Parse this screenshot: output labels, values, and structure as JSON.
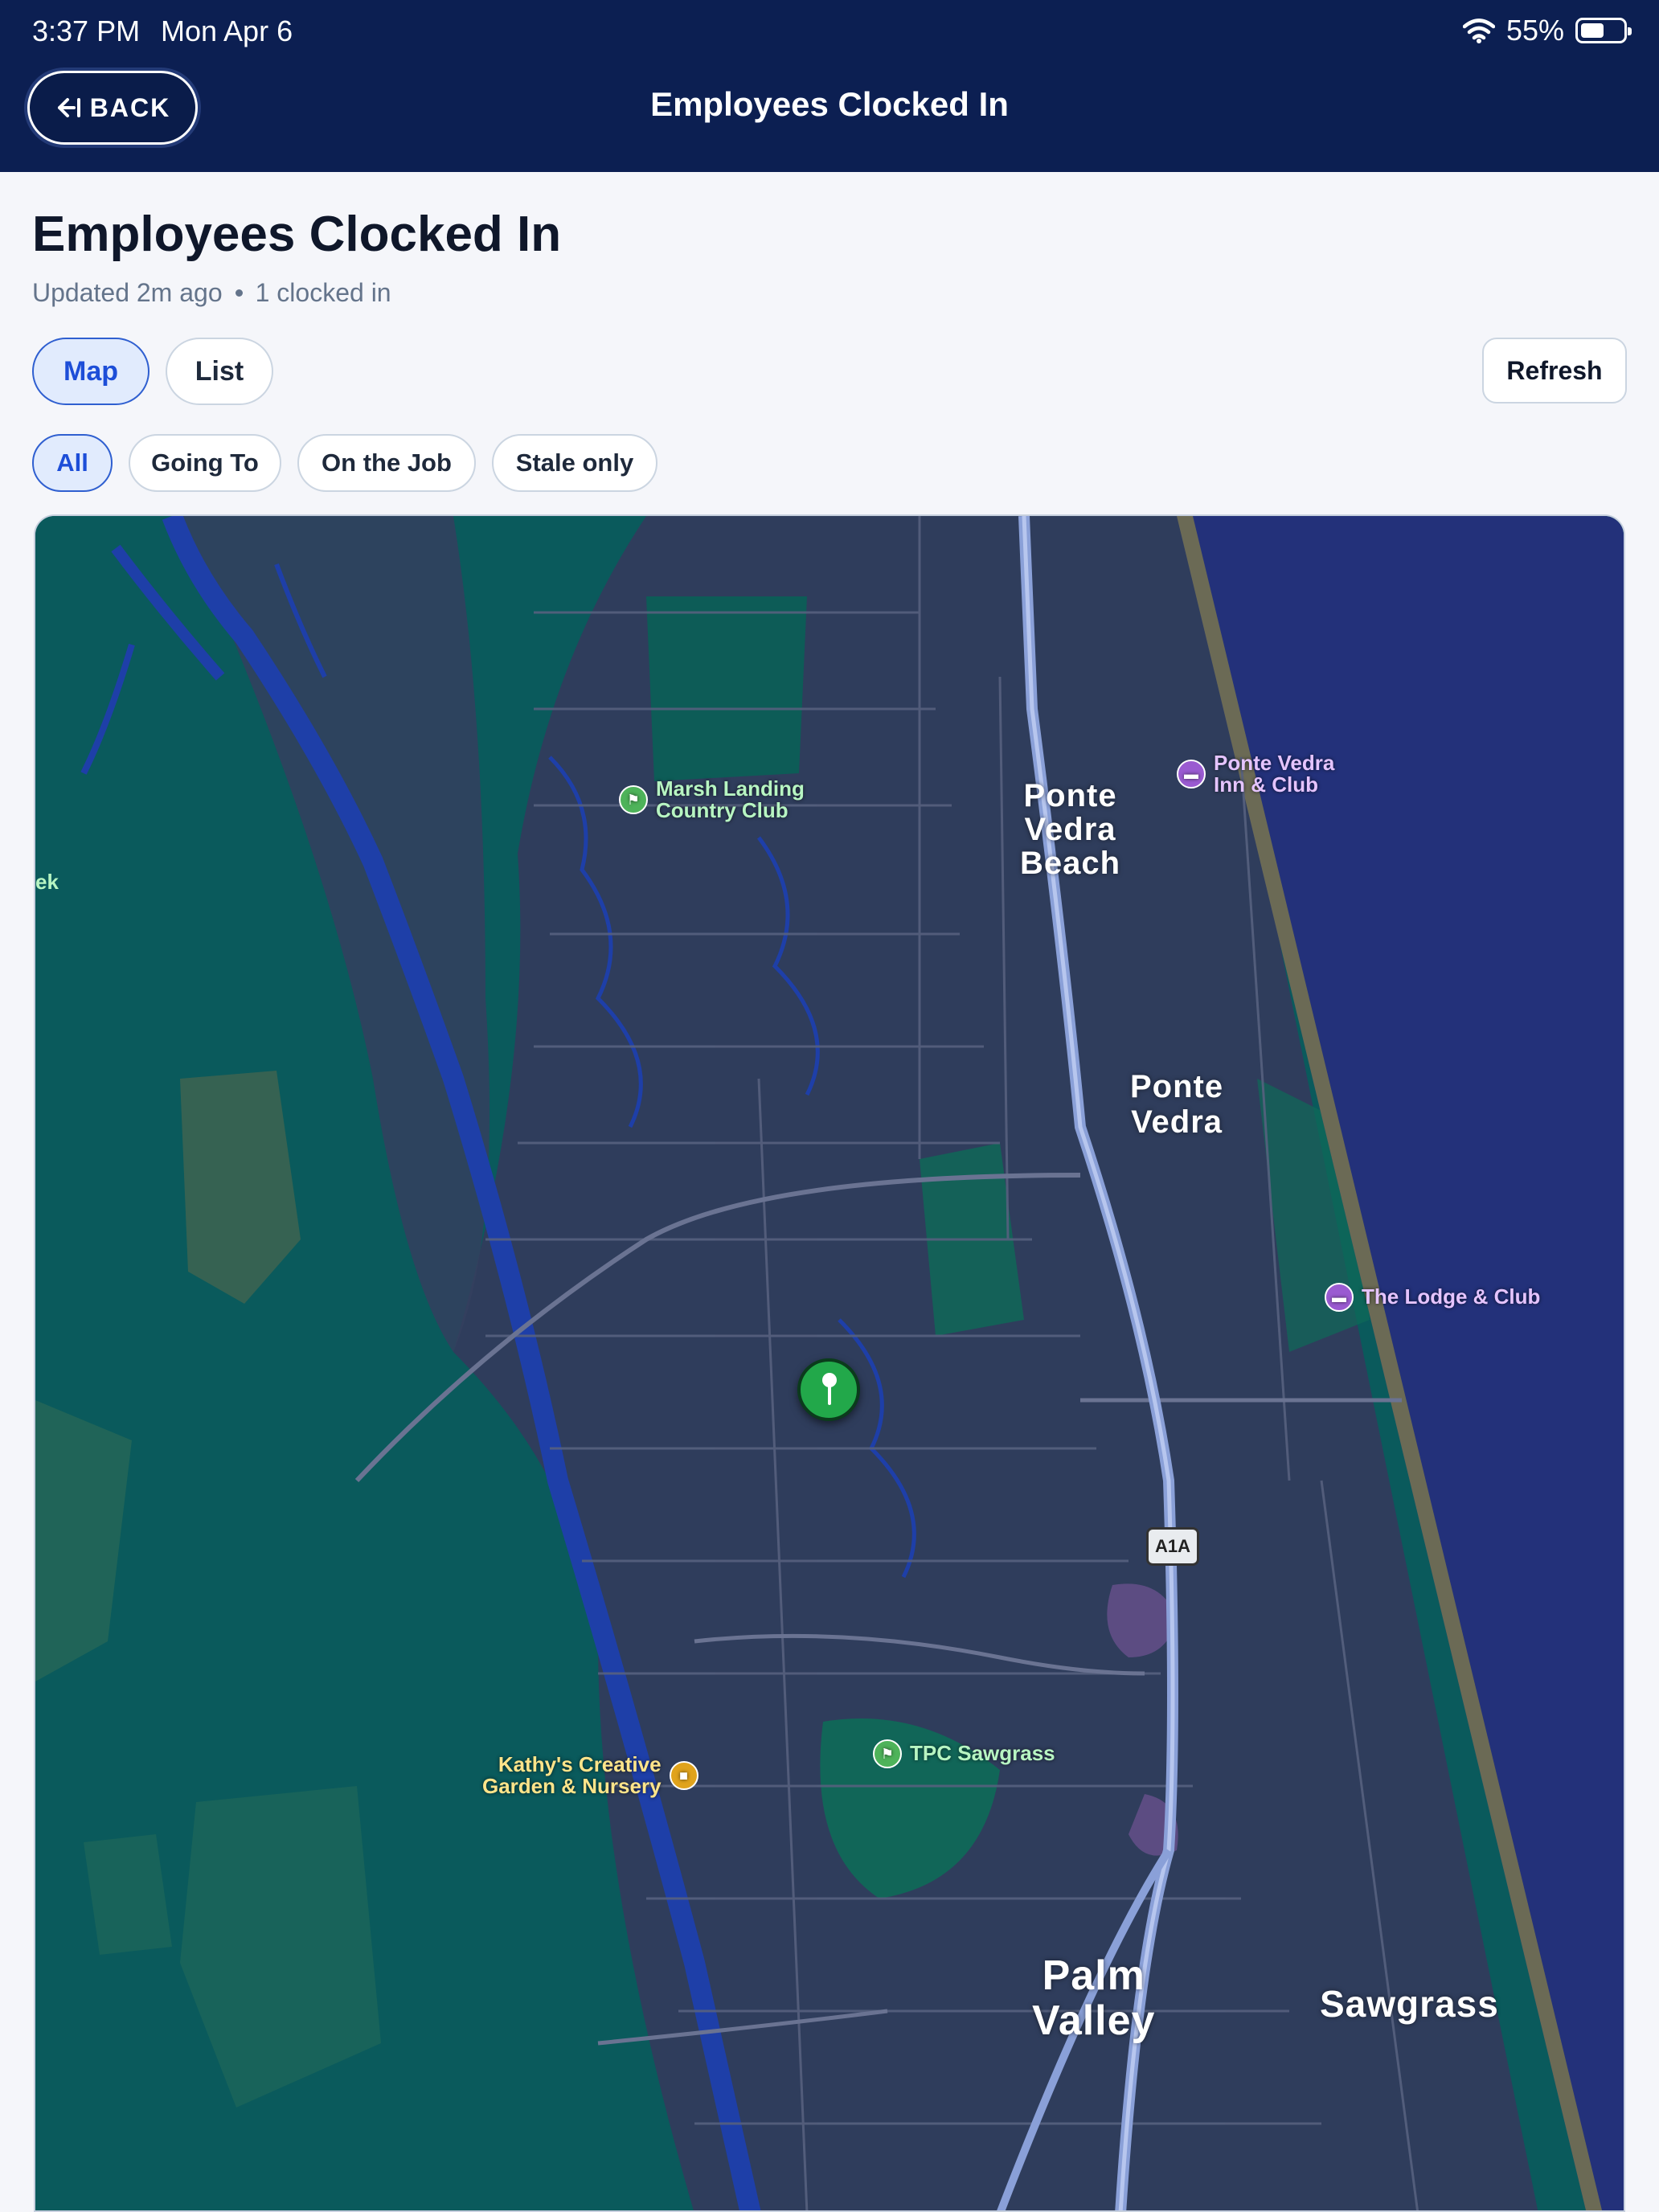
{
  "status_bar": {
    "time": "3:37 PM",
    "date": "Mon Apr 6",
    "battery": "55%",
    "battery_level": 0.55,
    "icons": [
      "wifi-icon",
      "battery-icon"
    ]
  },
  "header": {
    "back_label": "BACK",
    "back_icon": "arrow-left-bar-icon",
    "title": "Employees Clocked In"
  },
  "page": {
    "title": "Employees Clocked In",
    "updated": "Updated 2m ago",
    "count": "1 clocked in"
  },
  "view_toggle": {
    "options": [
      {
        "label": "Map",
        "active": true
      },
      {
        "label": "List",
        "active": false
      }
    ]
  },
  "refresh_label": "Refresh",
  "filters": [
    {
      "label": "All",
      "active": true
    },
    {
      "label": "Going To",
      "active": false
    },
    {
      "label": "On the Job",
      "active": false
    },
    {
      "label": "Stale only",
      "active": false
    }
  ],
  "map": {
    "towns": {
      "ponte_vedra_beach": [
        "Ponte",
        "Vedra",
        "Beach"
      ],
      "ponte_vedra": [
        "Ponte",
        "Vedra"
      ],
      "palm_valley": [
        "Palm",
        "Valley"
      ],
      "sawgrass": "Sawgrass"
    },
    "pois": {
      "marsh_landing": [
        "Marsh Landing",
        "Country Club"
      ],
      "ponte_vedra_inn": [
        "Ponte Vedra",
        "Inn & Club"
      ],
      "lodge": "The Lodge & Club",
      "tpc": "TPC Sawgrass",
      "kathys": [
        "Kathy's Creative",
        "Garden & Nursery"
      ]
    },
    "edge_label": "ek",
    "highway": "A1A",
    "colors": {
      "land": "#0a5a5c",
      "urban": "#2f3d5c",
      "ocean": "#23317a",
      "water": "#1e3fa8",
      "pin": "#22a84a"
    }
  }
}
